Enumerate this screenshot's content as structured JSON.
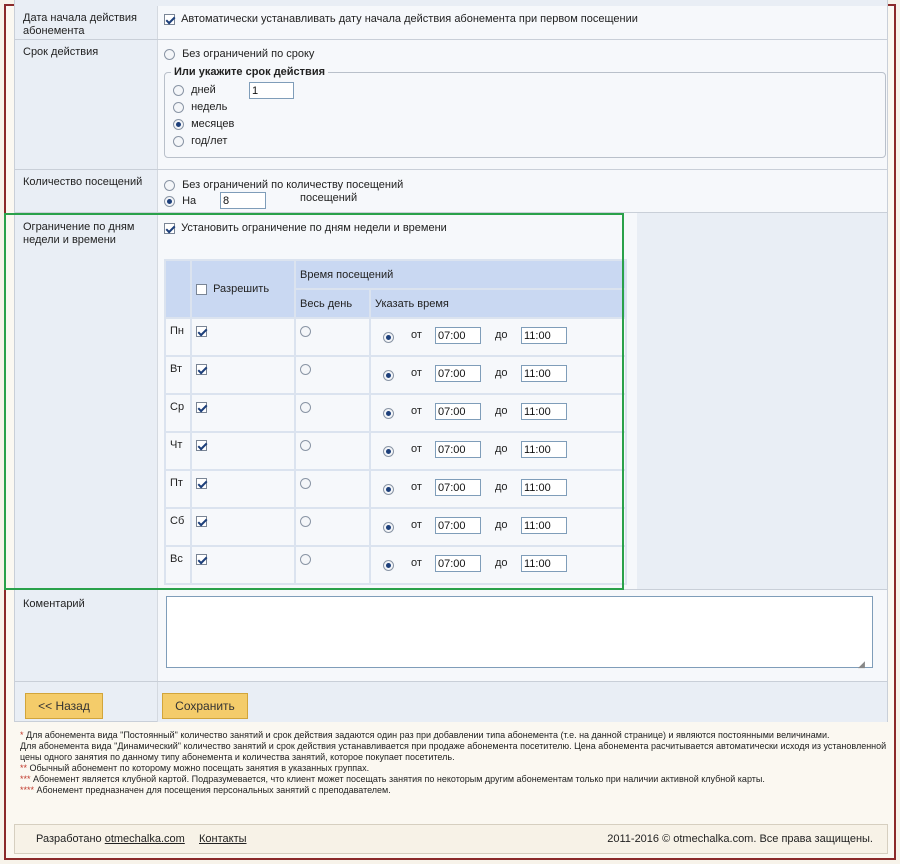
{
  "start_date": {
    "label": "Дата начала действия абонемента",
    "auto_checkbox_label": "Автоматически устанавливать дату начала действия абонемента при первом посещении",
    "auto_checked": true
  },
  "validity": {
    "label": "Срок действия",
    "unlimited_label": "Без ограничений по сроку",
    "legend": "Или укажите срок действия",
    "value": "1",
    "units": [
      {
        "label": "дней",
        "selected": false
      },
      {
        "label": "недель",
        "selected": false
      },
      {
        "label": "месяцев",
        "selected": true
      },
      {
        "label": "год/лет",
        "selected": false
      }
    ]
  },
  "visits": {
    "label": "Количество посещений",
    "unlimited_label": "Без ограничений по количеству посещений",
    "on_label": "На",
    "count": "8",
    "suffix": "посещений"
  },
  "restriction": {
    "label": "Ограничение по дням недели и времени",
    "checkbox_label": "Установить ограничение по дням недели и времени",
    "checked": true,
    "table": {
      "allow_label": "Разрешить",
      "time_header": "Время посещений",
      "all_day": "Весь день",
      "specify_time": "Указать время",
      "from_label": "от",
      "to_label": "до",
      "days": [
        {
          "name": "Пн",
          "allowed": true,
          "from": "07:00",
          "to": "11:00"
        },
        {
          "name": "Вт",
          "allowed": true,
          "from": "07:00",
          "to": "11:00"
        },
        {
          "name": "Ср",
          "allowed": true,
          "from": "07:00",
          "to": "11:00"
        },
        {
          "name": "Чт",
          "allowed": true,
          "from": "07:00",
          "to": "11:00"
        },
        {
          "name": "Пт",
          "allowed": true,
          "from": "07:00",
          "to": "11:00"
        },
        {
          "name": "Сб",
          "allowed": true,
          "from": "07:00",
          "to": "11:00"
        },
        {
          "name": "Вс",
          "allowed": true,
          "from": "07:00",
          "to": "11:00"
        }
      ]
    }
  },
  "comment": {
    "label": "Коментарий",
    "value": ""
  },
  "buttons": {
    "back": "<< Назад",
    "save": "Сохранить"
  },
  "notes": [
    {
      "stars": "*",
      "text": " Для абонемента вида \"Постоянный\" количество занятий и срок действия задаются один раз при добавлении типа абонемента (т.е. на данной странице) и являются постоянными величинами."
    },
    {
      "stars": "",
      "text": " Для абонемента вида \"Динамический\" количество занятий и срок действия устанавливается при продаже абонемента посетителю. Цена абонемента расчитывается автоматически исходя из установленной цены одного занятия по данному типу абонемента и количества занятий, которое покупает посетитель."
    },
    {
      "stars": "**",
      "text": " Обычный абонемент по которому можно посещать занятия в указанных группах."
    },
    {
      "stars": "***",
      "text": " Абонемент является клубной картой. Подразумевается, что клиент может посещать занятия по некоторым другим абонементам только при наличии активной клубной карты."
    },
    {
      "stars": "****",
      "text": " Абонемент предназначен для посещения персональных занятий с преподавателем."
    }
  ],
  "footer": {
    "developed_prefix": "Разработано",
    "developer_link": "otmechalka.com",
    "contacts": "Контакты",
    "copyright": "2011-2016 © otmechalka.com. Все права защищены."
  }
}
